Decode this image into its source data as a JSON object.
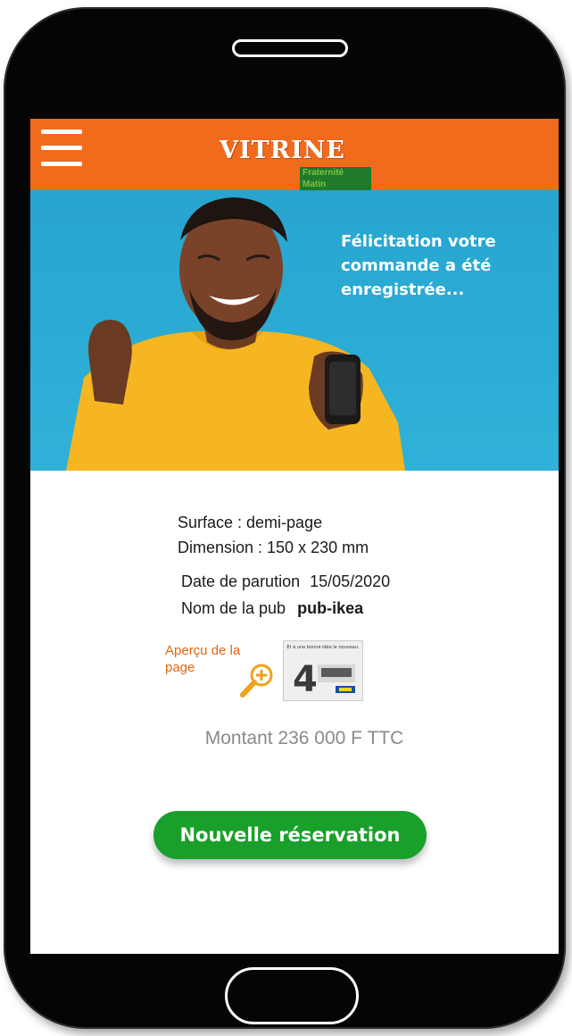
{
  "header": {
    "logo_title": "VITRINE",
    "logo_subtitle": "Fraternité Matin"
  },
  "hero": {
    "message": "Félicitation votre commande a été enregistrée..."
  },
  "order": {
    "surface": "Surface : demi-page",
    "dimension": "Dimension : 150 x 230 mm",
    "date_label": "Date de parution",
    "date_value": "15/05/2020",
    "ad_name_label": "Nom de la pub",
    "ad_name_value": "pub-ikea",
    "preview_label": "Aperçu de la page",
    "thumbnail_caption": "Et à une bonne idée le nouveau.",
    "amount": "Montant 236 000 F TTC"
  },
  "actions": {
    "new_booking_label": "Nouvelle réservation"
  },
  "colors": {
    "header": "#f26a1b",
    "hero_background": "#2fb1d8",
    "cta": "#19a02a",
    "preview_text": "#e06612"
  },
  "icons": [
    "menu-icon",
    "zoom-in-icon"
  ]
}
